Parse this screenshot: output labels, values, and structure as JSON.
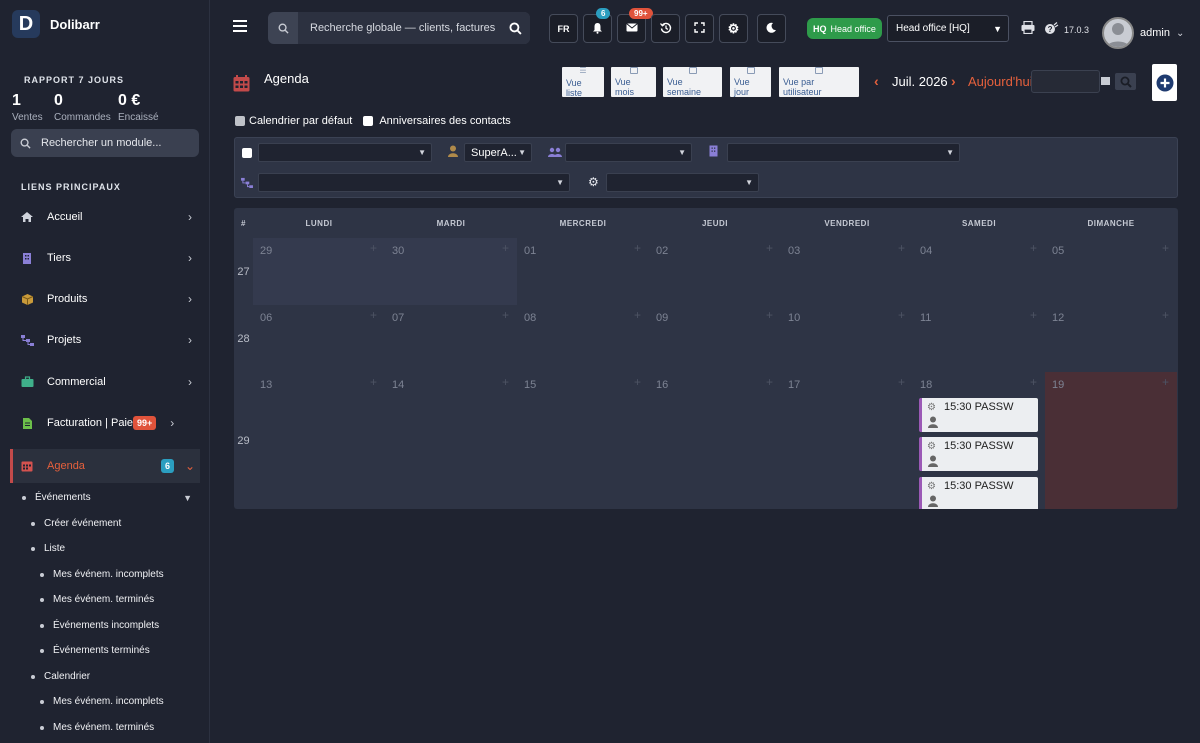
{
  "app": {
    "name": "Dolibarr"
  },
  "report": {
    "title": "RAPPORT 7 JOURS",
    "stats": [
      {
        "value": "1",
        "label": "Ventes"
      },
      {
        "value": "0",
        "label": "Commandes"
      },
      {
        "value": "0 €",
        "label": "Encaissé"
      }
    ]
  },
  "side_search": {
    "placeholder": "Rechercher un module..."
  },
  "links_title": "LIENS PRINCIPAUX",
  "menu": [
    {
      "label": "Accueil",
      "icon": "home-icon"
    },
    {
      "label": "Tiers",
      "icon": "building-icon"
    },
    {
      "label": "Produits",
      "icon": "box-icon"
    },
    {
      "label": "Projets",
      "icon": "project-icon"
    },
    {
      "label": "Commercial",
      "icon": "briefcase-icon"
    },
    {
      "label": "Facturation | Paiement",
      "icon": "invoice-icon",
      "badge": "99+"
    },
    {
      "label": "Agenda",
      "icon": "calendar-icon",
      "badge": "6"
    }
  ],
  "submenu": [
    {
      "label": "Événements",
      "level": 0
    },
    {
      "label": "Créer événement",
      "level": 1
    },
    {
      "label": "Liste",
      "level": 1
    },
    {
      "label": "Mes événem. incomplets",
      "level": 2
    },
    {
      "label": "Mes événem. terminés",
      "level": 2
    },
    {
      "label": "Événements incomplets",
      "level": 2
    },
    {
      "label": "Événements terminés",
      "level": 2
    },
    {
      "label": "Calendrier",
      "level": 1
    },
    {
      "label": "Mes événem. incomplets",
      "level": 2
    },
    {
      "label": "Mes événem. terminés",
      "level": 2
    }
  ],
  "topbar": {
    "search_placeholder": "Recherche globale — clients, factures",
    "lang": "FR",
    "notif_count": "6",
    "mail_count": "99+",
    "hq_badge": "HQ",
    "hq_label": "Head office",
    "entity": "Head office [HQ]",
    "version": "17.0.3",
    "user": "admin"
  },
  "page": {
    "title": "Agenda",
    "views": [
      "Vue liste",
      "Vue mois",
      "Vue semaine",
      "Vue jour",
      "Vue par utilisateur"
    ],
    "month": "Juil. 2026",
    "today": "Aujourd'hui",
    "check_default": "Calendrier par défaut",
    "check_birthdays": "Anniversaires des contacts",
    "filter_user": "SuperA..."
  },
  "calendar": {
    "week_col": "#",
    "days": [
      "LUNDI",
      "MARDI",
      "MERCREDI",
      "JEUDI",
      "VENDREDI",
      "SAMEDI",
      "DIMANCHE"
    ],
    "weeks": [
      {
        "num": "27",
        "dates": [
          "29",
          "30",
          "01",
          "02",
          "03",
          "04",
          "05"
        ]
      },
      {
        "num": "28",
        "dates": [
          "06",
          "07",
          "08",
          "09",
          "10",
          "11",
          "12"
        ]
      },
      {
        "num": "29",
        "dates": [
          "13",
          "14",
          "15",
          "16",
          "17",
          "18",
          "19"
        ]
      }
    ],
    "events": [
      {
        "label": "15:30 PASSW"
      },
      {
        "label": "15:30 PASSW"
      },
      {
        "label": "15:30 PASSW"
      }
    ],
    "colors": {
      "other_month": "#343a4e",
      "today": "#4a2f36",
      "event_border": "#9b59b6"
    }
  }
}
